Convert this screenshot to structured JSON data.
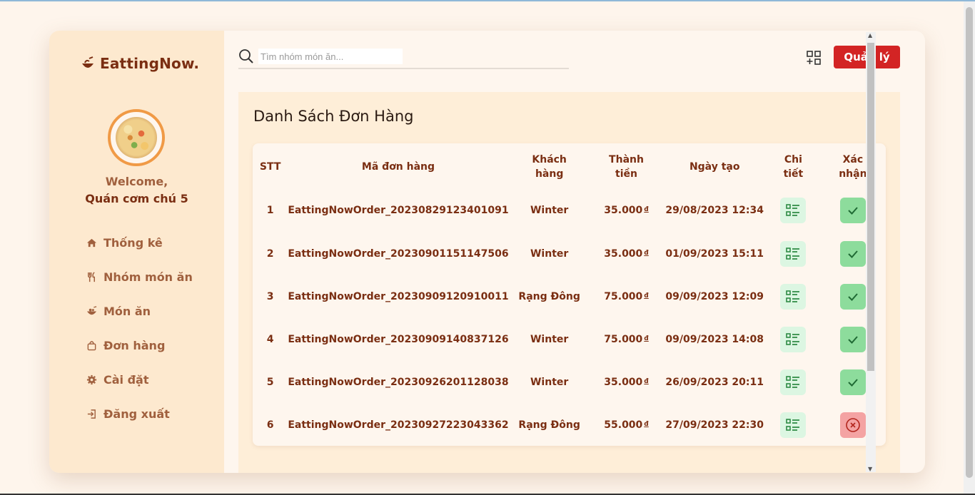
{
  "brand": {
    "name": "EattingNow."
  },
  "profile": {
    "welcome": "Welcome,",
    "shop_name": "Quán cơm chú 5"
  },
  "sidebar": {
    "items": [
      {
        "label": "Thống kê",
        "icon": "home-icon"
      },
      {
        "label": "Nhóm món ăn",
        "icon": "utensils-icon"
      },
      {
        "label": "Món ăn",
        "icon": "bowl-icon"
      },
      {
        "label": "Đơn hàng",
        "icon": "bag-icon"
      },
      {
        "label": "Cài đặt",
        "icon": "gear-icon"
      },
      {
        "label": "Đăng xuất",
        "icon": "logout-icon"
      }
    ]
  },
  "search": {
    "placeholder": "Tìm nhóm món ăn...",
    "value": ""
  },
  "header": {
    "manage_label": "Quản lý"
  },
  "orders": {
    "title": "Danh Sách Đơn Hàng",
    "columns": {
      "stt": "STT",
      "code": "Mã đơn hàng",
      "customer_1": "Khách",
      "customer_2": "hàng",
      "total_1": "Thành",
      "total_2": "tiền",
      "created": "Ngày tạo",
      "detail_1": "Chi",
      "detail_2": "tiết",
      "confirm_1": "Xác",
      "confirm_2": "nhận"
    },
    "currency": "đ",
    "rows": [
      {
        "stt": "1",
        "code": "EattingNowOrder_20230829123401091",
        "customer": "Winter",
        "total": "35.000",
        "created": "29/08/2023 12:34",
        "status": "confirmed"
      },
      {
        "stt": "2",
        "code": "EattingNowOrder_20230901151147506",
        "customer": "Winter",
        "total": "35.000",
        "created": "01/09/2023 15:11",
        "status": "confirmed"
      },
      {
        "stt": "3",
        "code": "EattingNowOrder_20230909120910011",
        "customer": "Rạng Đông",
        "total": "75.000",
        "created": "09/09/2023 12:09",
        "status": "confirmed"
      },
      {
        "stt": "4",
        "code": "EattingNowOrder_20230909140837126",
        "customer": "Winter",
        "total": "75.000",
        "created": "09/09/2023 14:08",
        "status": "confirmed"
      },
      {
        "stt": "5",
        "code": "EattingNowOrder_20230926201128038",
        "customer": "Winter",
        "total": "35.000",
        "created": "26/09/2023 20:11",
        "status": "confirmed"
      },
      {
        "stt": "6",
        "code": "EattingNowOrder_20230927223043362",
        "customer": "Rạng Đông",
        "total": "55.000",
        "created": "27/09/2023 22:30",
        "status": "cancelled"
      }
    ]
  },
  "colors": {
    "accent": "#d32424",
    "brand_text": "#7a2e12",
    "sidebar_bg": "#fde9cf",
    "confirm_green": "#8ddc9c",
    "cancel_red": "#f4a3a3"
  }
}
